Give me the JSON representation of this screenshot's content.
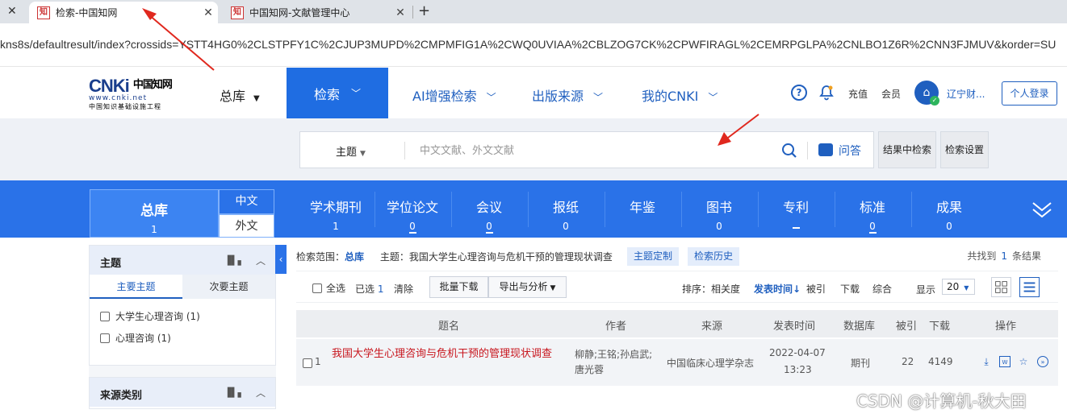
{
  "browser": {
    "tabs": [
      {
        "title": "检索-中国知网",
        "favicon": "知"
      },
      {
        "title": "中国知网-文献管理中心",
        "favicon": "知"
      }
    ],
    "close_glyph": "✕",
    "new_tab_glyph": "+",
    "url": "kns8s/defaultresult/index?crossids=YSTT4HG0%2CLSTPFY1C%2CJUP3MUPD%2CMPMFIG1A%2CWQ0UVIAA%2CBLZOG7CK%2CPWFIRAGL%2CEMRPGLPA%2CNLBO1Z6R%2CNN3FJMUV&korder=SU"
  },
  "header": {
    "logo_main": "CNKi",
    "logo_cn": "中国知网",
    "logo_url": "www.cnki.net",
    "logo_sub": "中国知识基础设施工程",
    "library": "总库",
    "nav": [
      "检索",
      "AI增强检索",
      "出版来源",
      "我的CNKI"
    ],
    "recharge": "充值",
    "member": "会员",
    "institution": "辽宁财...",
    "login": "个人登录"
  },
  "search": {
    "field": "主题",
    "placeholder": "中文文献、外文文献",
    "qa_label": "问答",
    "within_results": "结果中检索",
    "settings": "检索设置"
  },
  "databases": {
    "main": {
      "label": "总库",
      "count": "1"
    },
    "lang_cn": "中文",
    "lang_foreign": "外文",
    "tabs": [
      {
        "label": "学术期刊",
        "count": "1"
      },
      {
        "label": "学位论文",
        "count": "0"
      },
      {
        "label": "会议",
        "count": "0"
      },
      {
        "label": "报纸",
        "count": "0"
      },
      {
        "label": "年鉴",
        "count": ""
      },
      {
        "label": "图书",
        "count": "0"
      },
      {
        "label": "专利",
        "count": ""
      },
      {
        "label": "标准",
        "count": "0"
      },
      {
        "label": "成果",
        "count": "0"
      }
    ]
  },
  "facets": {
    "topic": {
      "title": "主题",
      "tab_main": "主要主题",
      "tab_secondary": "次要主题",
      "items": [
        {
          "label": "大学生心理咨询 (1)"
        },
        {
          "label": "心理咨询 (1)"
        }
      ]
    },
    "source": {
      "title": "来源类别"
    }
  },
  "results": {
    "scope_label": "检索范围：",
    "scope_value": "总库",
    "query": "主题：我国大学生心理咨询与危机干预的管理现状调查",
    "custom_topic": "主题定制",
    "history": "检索历史",
    "found_prefix": "共找到",
    "found_count": "1",
    "found_suffix": "条结果",
    "toolbar": {
      "select_all": "全选",
      "selected": "已选",
      "selected_count": "1",
      "clear": "清除",
      "batch_download": "批量下载",
      "export": "导出与分析",
      "sort_label": "排序：",
      "sort_relevance": "相关度",
      "sort_date": "发表时间",
      "sort_cited": "被引",
      "sort_download": "下载",
      "sort_composite": "综合",
      "display_label": "显示",
      "display_value": "20"
    },
    "columns": [
      "题名",
      "作者",
      "来源",
      "发表时间",
      "数据库",
      "被引",
      "下载",
      "操作"
    ],
    "rows": [
      {
        "index": "1",
        "title": "我国大学生心理咨询与危机干预的管理现状调查",
        "authors": "柳静;王铭;孙启武;唐光蓉",
        "source": "中国临床心理学杂志",
        "date": "2022-04-07",
        "time": "13:23",
        "database": "期刊",
        "cited": "22",
        "downloads": "4149"
      }
    ]
  },
  "watermark": "CSDN @计算机-秋大田",
  "colors": {
    "brand_blue": "#1f6de2",
    "db_bar": "#2a72e8",
    "title_red": "#c8161e",
    "annotation_arrow": "#e0281e"
  }
}
